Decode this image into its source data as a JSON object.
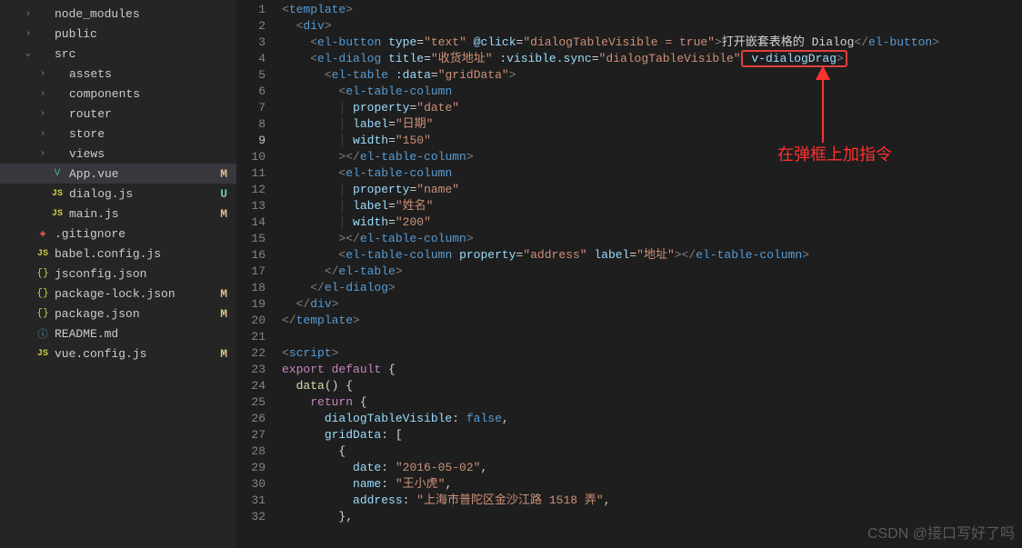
{
  "sidebar": {
    "items": [
      {
        "name": "node_modules",
        "depth": 1,
        "chev": "›",
        "kind": "folder",
        "badge": ""
      },
      {
        "name": "public",
        "depth": 1,
        "chev": "›",
        "kind": "folder",
        "badge": ""
      },
      {
        "name": "src",
        "depth": 1,
        "chev": "⌄",
        "kind": "folder",
        "badge": ""
      },
      {
        "name": "assets",
        "depth": 2,
        "chev": "›",
        "kind": "folder",
        "badge": ""
      },
      {
        "name": "components",
        "depth": 2,
        "chev": "›",
        "kind": "folder",
        "badge": ""
      },
      {
        "name": "router",
        "depth": 2,
        "chev": "›",
        "kind": "folder",
        "badge": ""
      },
      {
        "name": "store",
        "depth": 2,
        "chev": "›",
        "kind": "folder",
        "badge": ""
      },
      {
        "name": "views",
        "depth": 2,
        "chev": "›",
        "kind": "folder",
        "badge": ""
      },
      {
        "name": "App.vue",
        "depth": 2,
        "chev": "",
        "kind": "vue",
        "badge": "M",
        "active": true
      },
      {
        "name": "dialog.js",
        "depth": 2,
        "chev": "",
        "kind": "js",
        "badge": "U"
      },
      {
        "name": "main.js",
        "depth": 2,
        "chev": "",
        "kind": "js",
        "badge": "M"
      },
      {
        "name": ".gitignore",
        "depth": 1,
        "chev": "",
        "kind": "git",
        "badge": ""
      },
      {
        "name": "babel.config.js",
        "depth": 1,
        "chev": "",
        "kind": "js",
        "badge": ""
      },
      {
        "name": "jsconfig.json",
        "depth": 1,
        "chev": "",
        "kind": "json",
        "badge": ""
      },
      {
        "name": "package-lock.json",
        "depth": 1,
        "chev": "",
        "kind": "json",
        "badge": "M"
      },
      {
        "name": "package.json",
        "depth": 1,
        "chev": "",
        "kind": "json",
        "badge": "M"
      },
      {
        "name": "README.md",
        "depth": 1,
        "chev": "",
        "kind": "info",
        "badge": ""
      },
      {
        "name": "vue.config.js",
        "depth": 1,
        "chev": "",
        "kind": "js",
        "badge": "M"
      }
    ]
  },
  "editor": {
    "current_line": 9,
    "lines": {
      "l1": {
        "tag_open": "<",
        "name": "template",
        "tag_close": ">"
      },
      "l2": {
        "div": "div"
      },
      "l3": {
        "el": "el-button",
        "type_attr": "type",
        "type_val": "\"text\"",
        "click_attr": "@click",
        "click_val": "\"dialogTableVisible = true\"",
        "text": "打开嵌套表格的 Dialog",
        "close": "el-button"
      },
      "l4": {
        "el": "el-dialog",
        "title_attr": "title",
        "title_val": "\"收货地址\"",
        "vis_attr": ":visible.sync",
        "vis_val": "\"dialogTableVisible\"",
        "drag": "v-dialogDrag"
      },
      "l5": {
        "el": "el-table",
        "data_attr": ":data",
        "data_val": "\"gridData\""
      },
      "l6": {
        "el": "el-table-column"
      },
      "l7": {
        "attr": "property",
        "val": "\"date\""
      },
      "l8": {
        "attr": "label",
        "val": "\"日期\""
      },
      "l9": {
        "attr": "width",
        "val": "\"150\""
      },
      "l10": {
        "close": "el-table-column"
      },
      "l11": {
        "el": "el-table-column"
      },
      "l12": {
        "attr": "property",
        "val": "\"name\""
      },
      "l13": {
        "attr": "label",
        "val": "\"姓名\""
      },
      "l14": {
        "attr": "width",
        "val": "\"200\""
      },
      "l15": {
        "close": "el-table-column"
      },
      "l16": {
        "el": "el-table-column",
        "prop_attr": "property",
        "prop_val": "\"address\"",
        "label_attr": "label",
        "label_val": "\"地址\"",
        "close": "el-table-column"
      },
      "l17": {
        "close": "el-table"
      },
      "l18": {
        "close": "el-dialog"
      },
      "l19": {
        "close": "div"
      },
      "l20": {
        "close": "template"
      },
      "l22": {
        "name": "script"
      },
      "l23": {
        "export": "export",
        "default": "default"
      },
      "l24": {
        "fn": "data"
      },
      "l25": {
        "ret": "return"
      },
      "l26": {
        "prop": "dialogTableVisible",
        "val": "false"
      },
      "l27": {
        "prop": "gridData"
      },
      "l29": {
        "prop": "date",
        "val": "\"2016-05-02\""
      },
      "l30": {
        "prop": "name",
        "val": "\"王小虎\""
      },
      "l31": {
        "prop": "address",
        "val": "\"上海市普陀区金沙江路 1518 弄\""
      }
    }
  },
  "annotation": {
    "text": "在弹框上加指令"
  },
  "watermark": "CSDN @接口写好了吗"
}
